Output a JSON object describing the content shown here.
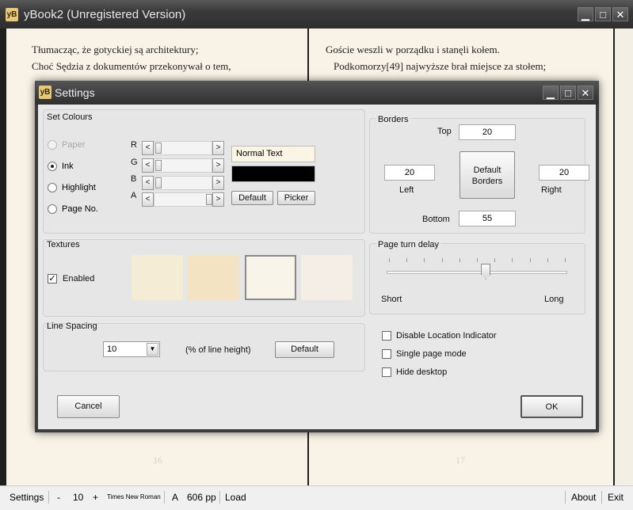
{
  "window": {
    "app_icon": "yB",
    "title": "yBook2 (Unregistered Version)",
    "minimize": "▁",
    "maximize": "□",
    "close": "✕"
  },
  "book": {
    "left_lines": [
      "Tłumacząc,    że gotyckiej są architektury;",
      "Choć Sędzia z dokumentów przekonywał o tem,"
    ],
    "right_lines": [
      "Goście weszli w porządku i stanęli kołem.",
      "Podkomorzy[49]  najwyższe brał miejsce za stołem;"
    ],
    "left_page_num": "16",
    "right_page_num": "17"
  },
  "status": {
    "settings": "Settings",
    "minus": "-",
    "font_size": "10",
    "plus": "+",
    "font_name": "Times New Roman",
    "font_icon": "A",
    "pages": "606 pp",
    "load": "Load",
    "about": "About",
    "exit": "Exit"
  },
  "dialog": {
    "app_icon": "yB",
    "title": "Settings",
    "minimize": "▁",
    "maximize": "□",
    "close": "✕",
    "colours": {
      "label": "Set Colours",
      "options": [
        {
          "label": "Paper",
          "checked": false,
          "disabled": true
        },
        {
          "label": "Ink",
          "checked": true,
          "disabled": false
        },
        {
          "label": "Highlight",
          "checked": false,
          "disabled": false
        },
        {
          "label": "Page No.",
          "checked": false,
          "disabled": false
        }
      ],
      "channels": [
        "R",
        "G",
        "B",
        "A"
      ],
      "channel_levels": [
        0,
        0,
        0,
        1
      ],
      "arrow_left": "<",
      "arrow_right": ">",
      "preview_text": "Normal Text",
      "ink_color": "#000000",
      "default_button": "Default",
      "picker_button": "Picker"
    },
    "borders": {
      "label": "Borders",
      "top_label": "Top",
      "top_value": "20",
      "left_label": "Left",
      "left_value": "20",
      "right_label": "Right",
      "right_value": "20",
      "bottom_label": "Bottom",
      "bottom_value": "55",
      "default_button_line1": "Default",
      "default_button_line2": "Borders"
    },
    "textures": {
      "label": "Textures",
      "enabled_label": "Enabled",
      "enabled": true,
      "swatches": [
        "#f4ecd4",
        "#f3e3c2",
        "#f8f4ea",
        "#f4eee6"
      ],
      "selected_index": 2
    },
    "page_turn": {
      "label": "Page turn delay",
      "short_label": "Short",
      "long_label": "Long",
      "level": 0.55
    },
    "line_spacing": {
      "label": "Line Spacing",
      "value": "10",
      "dropdown_arrow": "▼",
      "hint": "(% of line height)",
      "default_button": "Default"
    },
    "options": [
      {
        "label": "Disable Location Indicator",
        "checked": false
      },
      {
        "label": "Single page mode",
        "checked": false
      },
      {
        "label": "Hide desktop",
        "checked": false
      }
    ],
    "cancel_button": "Cancel",
    "ok_button": "OK"
  }
}
